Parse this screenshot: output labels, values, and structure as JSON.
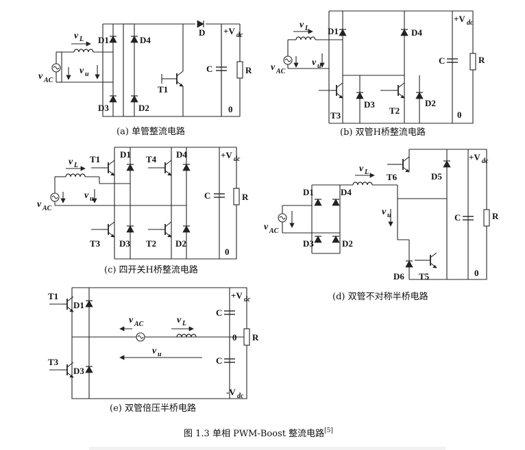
{
  "header_text": "",
  "figure_caption": "图 1.3 单相 PWM-Boost 整流电路",
  "figure_ref": "[5]",
  "panels": {
    "a": {
      "caption": "(a) 单管整流电路",
      "labels": {
        "vl": "v",
        "vl_sub": "L",
        "vac": "v",
        "vac_sub": "AC",
        "vu": "v",
        "vu_sub": "u",
        "d1": "D1",
        "d2": "D2",
        "d3": "D3",
        "d4": "D4",
        "d": "D",
        "t1": "T1",
        "c": "C",
        "r": "R",
        "vdc": "+V",
        "vdc_sub": "dc",
        "zero": "0"
      }
    },
    "b": {
      "caption": "(b) 双管H桥整流电路",
      "labels": {
        "vl": "v",
        "vl_sub": "L",
        "vac": "v",
        "vac_sub": "AC",
        "vu": "v",
        "vu_sub": "u",
        "d1": "D1",
        "d2": "D2",
        "d3": "D3",
        "d4": "D4",
        "t2": "T2",
        "t3": "T3",
        "c": "C",
        "r": "R",
        "vdc": "+V",
        "vdc_sub": "dc",
        "zero": "0"
      }
    },
    "c": {
      "caption": "(c) 四开关H桥整流电路",
      "labels": {
        "vl": "v",
        "vl_sub": "L",
        "vac": "v",
        "vac_sub": "AC",
        "vu": "v",
        "vu_sub": "u",
        "t1": "T1",
        "t2": "T2",
        "t3": "T3",
        "t4": "T4",
        "d1": "D1",
        "d2": "D2",
        "d3": "D3",
        "d4": "D4",
        "c": "C",
        "r": "R",
        "vdc": "+V",
        "vdc_sub": "dc",
        "zero": "0"
      }
    },
    "d": {
      "caption": "(d) 双管不对称半桥电路",
      "labels": {
        "vl": "v",
        "vl_sub": "L",
        "vac": "v",
        "vac_sub": "AC",
        "vu": "v",
        "vu_sub": "u",
        "d1": "D1",
        "d2": "D2",
        "d3": "D3",
        "d4": "D4",
        "d5": "D5",
        "d6": "D6",
        "t5": "T5",
        "t6": "T6",
        "c": "C",
        "r": "R",
        "vdc": "+V",
        "vdc_sub": "dc",
        "zero": "0"
      }
    },
    "e": {
      "caption": "(e) 双管倍压半桥电路",
      "labels": {
        "vl": "v",
        "vl_sub": "L",
        "vac": "v",
        "vac_sub": "AC",
        "vu": "v",
        "vu_sub": "u",
        "t1": "T1",
        "t3": "T3",
        "d1": "D1",
        "d3": "D3",
        "c_top": "C",
        "c_bot": "C",
        "r": "R",
        "vdc_pos": "+V",
        "vdc_neg": "-V",
        "vdc_sub": "dc",
        "zero": "0"
      }
    }
  }
}
